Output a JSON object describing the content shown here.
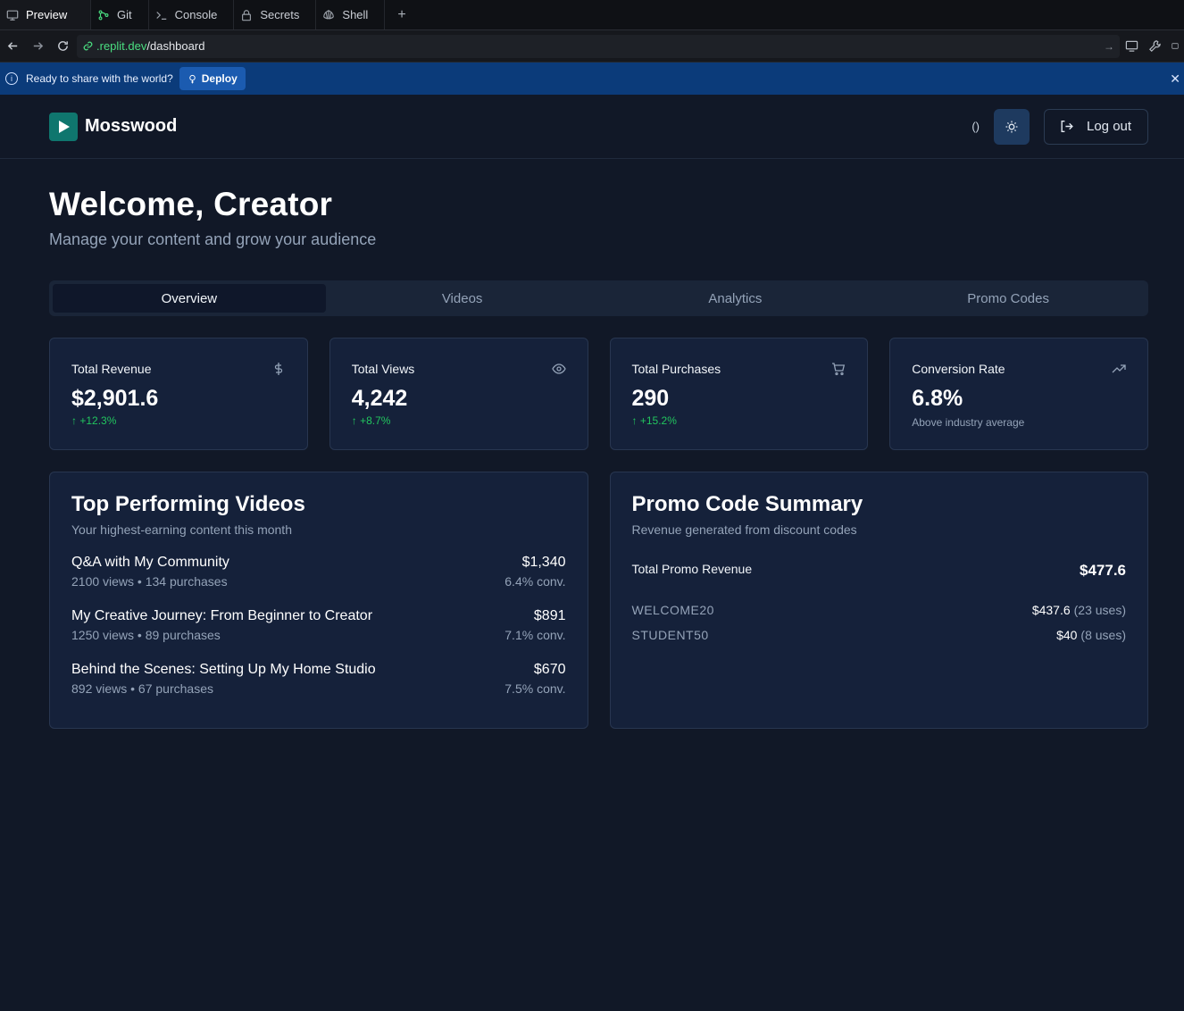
{
  "ide": {
    "tabs": [
      {
        "label": "Preview",
        "icon": "monitor-icon"
      },
      {
        "label": "Git",
        "icon": "git-icon"
      },
      {
        "label": "Console",
        "icon": "terminal-icon"
      },
      {
        "label": "Secrets",
        "icon": "lock-icon"
      },
      {
        "label": "Shell",
        "icon": "shell-icon"
      }
    ],
    "new_tab": "+",
    "url_domain": ".replit.dev",
    "url_path": "/dashboard",
    "banner_text": "Ready to share with the world?",
    "deploy_label": "Deploy"
  },
  "app": {
    "brand": "Mosswood",
    "paren": "()",
    "logout": "Log out",
    "welcome": "Welcome, Creator",
    "subtitle": "Manage your content and grow your audience",
    "tabs": [
      "Overview",
      "Videos",
      "Analytics",
      "Promo Codes"
    ],
    "active_tab": "Overview",
    "stats": [
      {
        "label": "Total Revenue",
        "value": "$2,901.6",
        "change": "+12.3%",
        "icon": "dollar-icon"
      },
      {
        "label": "Total Views",
        "value": "4,242",
        "change": "+8.7%",
        "icon": "eye-icon"
      },
      {
        "label": "Total Purchases",
        "value": "290",
        "change": "+15.2%",
        "icon": "cart-icon"
      },
      {
        "label": "Conversion Rate",
        "value": "6.8%",
        "note": "Above industry average",
        "icon": "trending-up-icon"
      }
    ],
    "top_videos": {
      "title": "Top Performing Videos",
      "subtitle": "Your highest-earning content this month",
      "items": [
        {
          "name": "Q&A with My Community",
          "meta": "2100 views • 134 purchases",
          "revenue": "$1,340",
          "conv": "6.4% conv."
        },
        {
          "name": "My Creative Journey: From Beginner to Creator",
          "meta": "1250 views • 89 purchases",
          "revenue": "$891",
          "conv": "7.1% conv."
        },
        {
          "name": "Behind the Scenes: Setting Up My Home Studio",
          "meta": "892 views • 67 purchases",
          "revenue": "$670",
          "conv": "7.5% conv."
        }
      ]
    },
    "promo": {
      "title": "Promo Code Summary",
      "subtitle": "Revenue generated from discount codes",
      "total_label": "Total Promo Revenue",
      "total_value": "$477.6",
      "codes": [
        {
          "code": "WELCOME20",
          "amount": "$437.6",
          "uses": "(23 uses)"
        },
        {
          "code": "STUDENT50",
          "amount": "$40",
          "uses": "(8 uses)"
        }
      ]
    }
  },
  "colors": {
    "accent_green": "#22c55e",
    "banner_blue": "#0b3b7a",
    "logo_teal": "#0f766e",
    "bg": "#111827"
  }
}
